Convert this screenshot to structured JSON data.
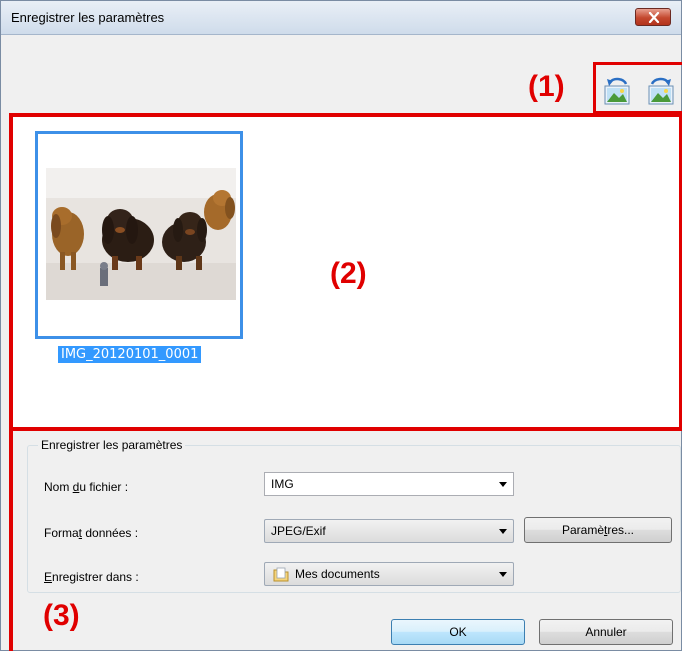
{
  "window": {
    "title": "Enregistrer les paramètres"
  },
  "callouts": {
    "one": "(1)",
    "two": "(2)",
    "three": "(3)"
  },
  "toolbar": {
    "rotate_left_icon": "rotate-left-icon",
    "rotate_right_icon": "rotate-right-icon"
  },
  "thumbnail": {
    "filename": "IMG_20120101_0001"
  },
  "settings": {
    "group_title": "Enregistrer les paramètres",
    "file_name": {
      "label_pre": "Nom ",
      "label_ul": "d",
      "label_post": "u fichier :",
      "value": "IMG"
    },
    "data_format": {
      "label_pre": "Forma",
      "label_ul": "t",
      "label_post": " données :",
      "value": "JPEG/Exif"
    },
    "save_in": {
      "label_pre": "",
      "label_ul": "E",
      "label_post": "nregistrer dans :",
      "value": "Mes documents"
    },
    "params_button": {
      "pre": "Paramè",
      "ul": "t",
      "post": "res..."
    }
  },
  "buttons": {
    "ok": "OK",
    "cancel": "Annuler"
  },
  "colors": {
    "annotation_red": "#e00000",
    "selection_blue": "#3399ff",
    "thumb_border": "#3d90e8"
  }
}
